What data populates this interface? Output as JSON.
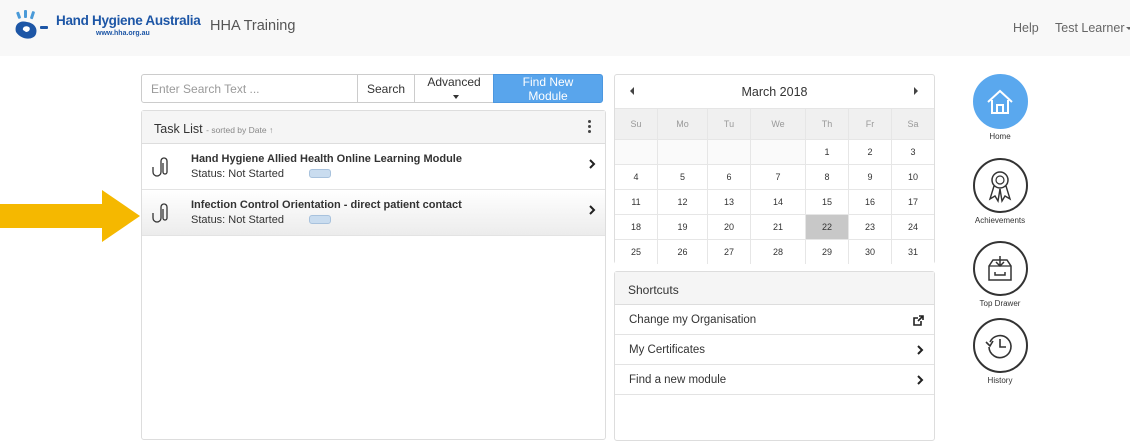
{
  "header": {
    "logo_name": "Hand Hygiene Australia",
    "logo_url": "www.hha.org.au",
    "app_title": "HHA Training",
    "help": "Help",
    "user": "Test Learner"
  },
  "search": {
    "placeholder": "Enter Search Text ...",
    "search_button": "Search",
    "advanced_button": "Advanced",
    "find_button": "Find New Module"
  },
  "task_list": {
    "title": "Task List",
    "sort_note": "- sorted by Date ↑",
    "items": [
      {
        "title": "Hand Hygiene Allied Health Online Learning Module",
        "status": "Status: Not Started"
      },
      {
        "title": "Infection Control Orientation - direct patient contact",
        "status": "Status: Not Started"
      }
    ]
  },
  "calendar": {
    "month": "March 2018",
    "days_of_week": [
      "Su",
      "Mo",
      "Tu",
      "We",
      "Th",
      "Fr",
      "Sa"
    ],
    "weeks": [
      [
        "",
        "",
        "",
        "",
        "1",
        "2",
        "3"
      ],
      [
        "4",
        "5",
        "6",
        "7",
        "8",
        "9",
        "10"
      ],
      [
        "11",
        "12",
        "13",
        "14",
        "15",
        "16",
        "17"
      ],
      [
        "18",
        "19",
        "20",
        "21",
        "22",
        "23",
        "24"
      ],
      [
        "25",
        "26",
        "27",
        "28",
        "29",
        "30",
        "31"
      ]
    ],
    "today": "22"
  },
  "shortcuts": {
    "title": "Shortcuts",
    "items": [
      "Change my Organisation",
      "My Certificates",
      "Find a new module"
    ]
  },
  "sidebar": {
    "items": [
      {
        "label": "Home",
        "icon": "home-icon"
      },
      {
        "label": "Achievements",
        "icon": "ribbon-icon"
      },
      {
        "label": "Top Drawer",
        "icon": "drawer-icon"
      },
      {
        "label": "History",
        "icon": "history-icon"
      }
    ]
  },
  "colors": {
    "brand_blue": "#1d56a6",
    "button_blue": "#59a5ec",
    "highlight_arrow": "#f5b800",
    "today_cell": "#c8c8c8"
  }
}
